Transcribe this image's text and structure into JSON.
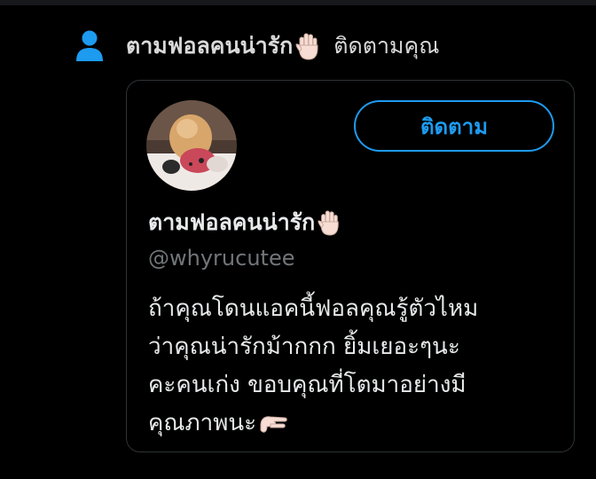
{
  "notification": {
    "account_name": "ตามฟอลคนน่ารัก",
    "action_text": "ติดตามคุณ"
  },
  "card": {
    "follow_label": "ติดตาม",
    "name": "ตามฟอลคนน่ารัก",
    "handle": "@whyrucutee",
    "bio_lines": [
      "ถ้าคุณโดนแอคนี้ฟอลคุณรู้ตัวไหม",
      "ว่าคุณน่ารักม้ากกก ยิ้มเยอะๆนะ",
      "คะคนเก่ง ขอบคุณที่โตมาอย่างมี",
      "คุณภาพนะ"
    ]
  },
  "icons": {
    "person": "person-icon",
    "waving_hand": "waving-hand-emoji",
    "pinching_hand": "pinching-hand-emoji"
  },
  "colors": {
    "accent": "#1d9bf0",
    "background": "#000000",
    "border": "#2f3336",
    "secondary_text": "#71767b",
    "primary_text": "#e7e9ea",
    "skin": "#f7ddd4"
  }
}
